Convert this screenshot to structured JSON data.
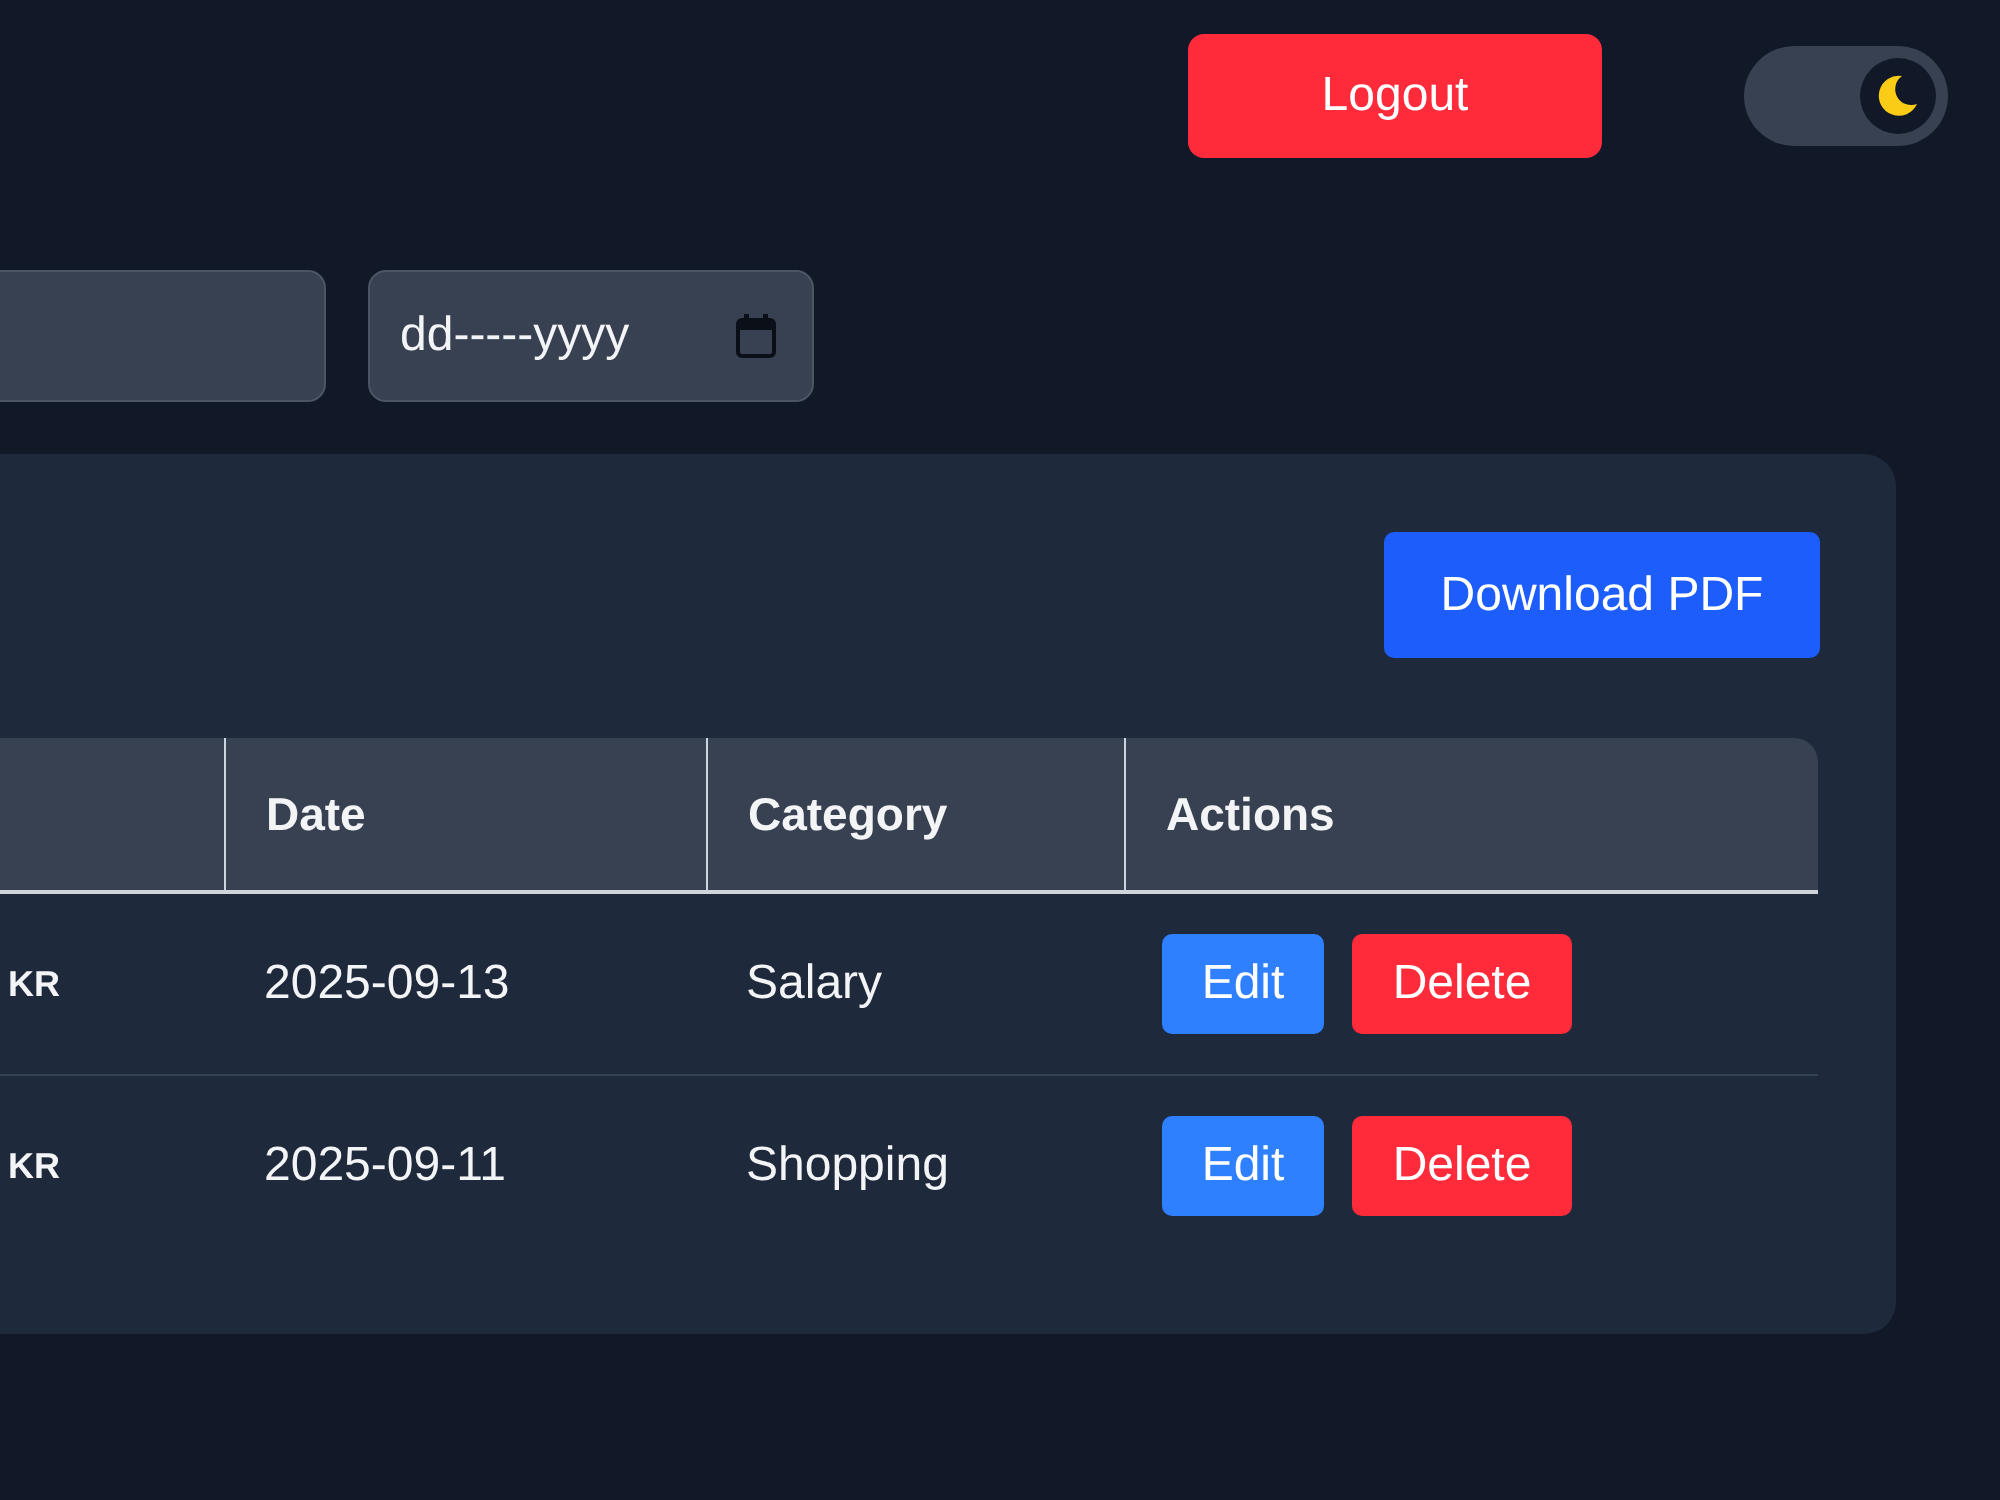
{
  "header": {
    "logout_button": "Logout",
    "theme_toggle": {
      "on": true
    }
  },
  "filters": [
    {
      "kind": "text"
    },
    {
      "kind": "date",
      "placeholder": "dd-----yyyy"
    }
  ],
  "card": {
    "download_button": "Download PDF",
    "table": {
      "columns": [
        "Date",
        "Category",
        "Actions"
      ],
      "rows": [
        {
          "column_1": "KR",
          "date": "2025-09-13",
          "category": "Salary",
          "actions": [
            {
              "kind": "edit",
              "label": "Edit"
            },
            {
              "kind": "delete",
              "label": "Delete"
            }
          ]
        },
        {
          "column_1": "KR",
          "date": "2025-09-11",
          "category": "Shopping",
          "actions": [
            {
              "kind": "edit",
              "label": "Edit"
            },
            {
              "kind": "delete",
              "label": "Delete"
            }
          ]
        }
      ]
    }
  }
}
